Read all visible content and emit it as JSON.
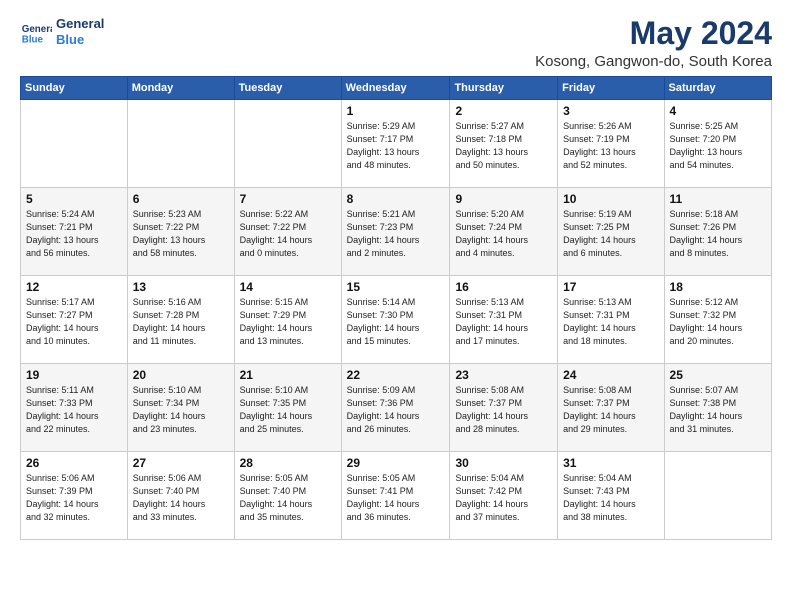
{
  "logo": {
    "line1": "General",
    "line2": "Blue"
  },
  "title": "May 2024",
  "location": "Kosong, Gangwon-do, South Korea",
  "days_of_week": [
    "Sunday",
    "Monday",
    "Tuesday",
    "Wednesday",
    "Thursday",
    "Friday",
    "Saturday"
  ],
  "weeks": [
    [
      {
        "day": "",
        "info": ""
      },
      {
        "day": "",
        "info": ""
      },
      {
        "day": "",
        "info": ""
      },
      {
        "day": "1",
        "info": "Sunrise: 5:29 AM\nSunset: 7:17 PM\nDaylight: 13 hours\nand 48 minutes."
      },
      {
        "day": "2",
        "info": "Sunrise: 5:27 AM\nSunset: 7:18 PM\nDaylight: 13 hours\nand 50 minutes."
      },
      {
        "day": "3",
        "info": "Sunrise: 5:26 AM\nSunset: 7:19 PM\nDaylight: 13 hours\nand 52 minutes."
      },
      {
        "day": "4",
        "info": "Sunrise: 5:25 AM\nSunset: 7:20 PM\nDaylight: 13 hours\nand 54 minutes."
      }
    ],
    [
      {
        "day": "5",
        "info": "Sunrise: 5:24 AM\nSunset: 7:21 PM\nDaylight: 13 hours\nand 56 minutes."
      },
      {
        "day": "6",
        "info": "Sunrise: 5:23 AM\nSunset: 7:22 PM\nDaylight: 13 hours\nand 58 minutes."
      },
      {
        "day": "7",
        "info": "Sunrise: 5:22 AM\nSunset: 7:22 PM\nDaylight: 14 hours\nand 0 minutes."
      },
      {
        "day": "8",
        "info": "Sunrise: 5:21 AM\nSunset: 7:23 PM\nDaylight: 14 hours\nand 2 minutes."
      },
      {
        "day": "9",
        "info": "Sunrise: 5:20 AM\nSunset: 7:24 PM\nDaylight: 14 hours\nand 4 minutes."
      },
      {
        "day": "10",
        "info": "Sunrise: 5:19 AM\nSunset: 7:25 PM\nDaylight: 14 hours\nand 6 minutes."
      },
      {
        "day": "11",
        "info": "Sunrise: 5:18 AM\nSunset: 7:26 PM\nDaylight: 14 hours\nand 8 minutes."
      }
    ],
    [
      {
        "day": "12",
        "info": "Sunrise: 5:17 AM\nSunset: 7:27 PM\nDaylight: 14 hours\nand 10 minutes."
      },
      {
        "day": "13",
        "info": "Sunrise: 5:16 AM\nSunset: 7:28 PM\nDaylight: 14 hours\nand 11 minutes."
      },
      {
        "day": "14",
        "info": "Sunrise: 5:15 AM\nSunset: 7:29 PM\nDaylight: 14 hours\nand 13 minutes."
      },
      {
        "day": "15",
        "info": "Sunrise: 5:14 AM\nSunset: 7:30 PM\nDaylight: 14 hours\nand 15 minutes."
      },
      {
        "day": "16",
        "info": "Sunrise: 5:13 AM\nSunset: 7:31 PM\nDaylight: 14 hours\nand 17 minutes."
      },
      {
        "day": "17",
        "info": "Sunrise: 5:13 AM\nSunset: 7:31 PM\nDaylight: 14 hours\nand 18 minutes."
      },
      {
        "day": "18",
        "info": "Sunrise: 5:12 AM\nSunset: 7:32 PM\nDaylight: 14 hours\nand 20 minutes."
      }
    ],
    [
      {
        "day": "19",
        "info": "Sunrise: 5:11 AM\nSunset: 7:33 PM\nDaylight: 14 hours\nand 22 minutes."
      },
      {
        "day": "20",
        "info": "Sunrise: 5:10 AM\nSunset: 7:34 PM\nDaylight: 14 hours\nand 23 minutes."
      },
      {
        "day": "21",
        "info": "Sunrise: 5:10 AM\nSunset: 7:35 PM\nDaylight: 14 hours\nand 25 minutes."
      },
      {
        "day": "22",
        "info": "Sunrise: 5:09 AM\nSunset: 7:36 PM\nDaylight: 14 hours\nand 26 minutes."
      },
      {
        "day": "23",
        "info": "Sunrise: 5:08 AM\nSunset: 7:37 PM\nDaylight: 14 hours\nand 28 minutes."
      },
      {
        "day": "24",
        "info": "Sunrise: 5:08 AM\nSunset: 7:37 PM\nDaylight: 14 hours\nand 29 minutes."
      },
      {
        "day": "25",
        "info": "Sunrise: 5:07 AM\nSunset: 7:38 PM\nDaylight: 14 hours\nand 31 minutes."
      }
    ],
    [
      {
        "day": "26",
        "info": "Sunrise: 5:06 AM\nSunset: 7:39 PM\nDaylight: 14 hours\nand 32 minutes."
      },
      {
        "day": "27",
        "info": "Sunrise: 5:06 AM\nSunset: 7:40 PM\nDaylight: 14 hours\nand 33 minutes."
      },
      {
        "day": "28",
        "info": "Sunrise: 5:05 AM\nSunset: 7:40 PM\nDaylight: 14 hours\nand 35 minutes."
      },
      {
        "day": "29",
        "info": "Sunrise: 5:05 AM\nSunset: 7:41 PM\nDaylight: 14 hours\nand 36 minutes."
      },
      {
        "day": "30",
        "info": "Sunrise: 5:04 AM\nSunset: 7:42 PM\nDaylight: 14 hours\nand 37 minutes."
      },
      {
        "day": "31",
        "info": "Sunrise: 5:04 AM\nSunset: 7:43 PM\nDaylight: 14 hours\nand 38 minutes."
      },
      {
        "day": "",
        "info": ""
      }
    ]
  ]
}
